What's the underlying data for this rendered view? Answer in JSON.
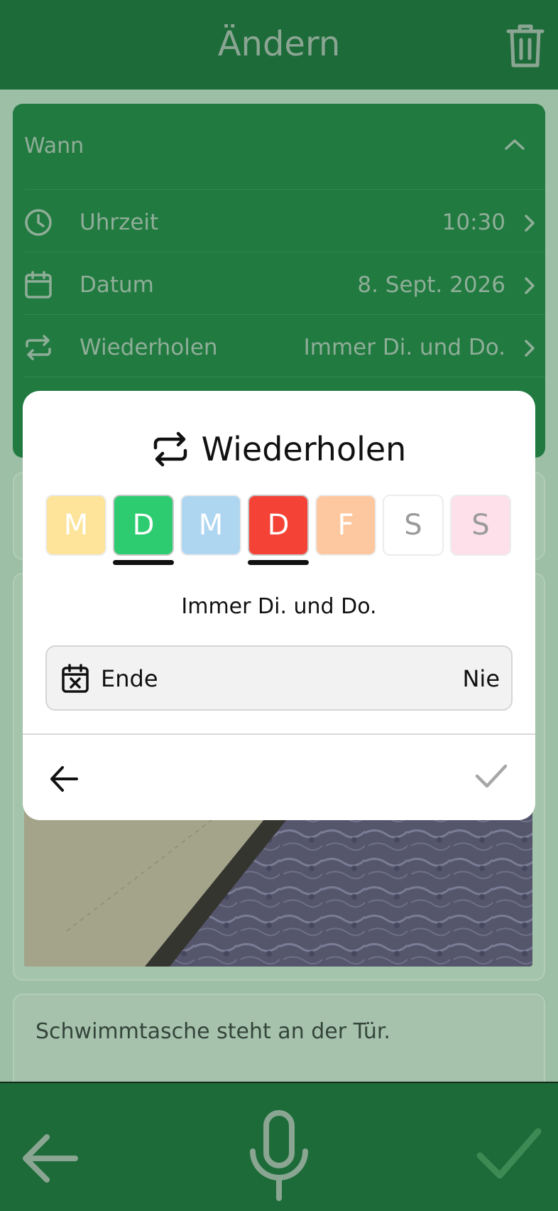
{
  "header": {
    "title": "Ändern",
    "trash_icon": "trash-icon"
  },
  "wann": {
    "title": "Wann",
    "rows": [
      {
        "label": "Uhrzeit",
        "value": "10:30",
        "icon": "clock-icon"
      },
      {
        "label": "Datum",
        "value": "8. Sept. 2026",
        "icon": "calendar-icon"
      },
      {
        "label": "Wiederholen",
        "value": "Immer Di. und Do.",
        "icon": "repeat-icon"
      }
    ]
  },
  "note": {
    "text": "Schwimmtasche steht an der Tür."
  },
  "modal": {
    "title": "Wiederholen",
    "days": [
      {
        "letter": "M",
        "color": "#fde49a",
        "selected": false
      },
      {
        "letter": "D",
        "color": "#2ecc71",
        "selected": true
      },
      {
        "letter": "M",
        "color": "#aed6f1",
        "selected": false
      },
      {
        "letter": "D",
        "color": "#f44336",
        "selected": true
      },
      {
        "letter": "F",
        "color": "#fdc8a0",
        "selected": false
      },
      {
        "letter": "S",
        "color": "#ffffff",
        "selected": false
      },
      {
        "letter": "S",
        "color": "#fde0ea",
        "selected": false
      }
    ],
    "summary": "Immer Di. und Do.",
    "end": {
      "label": "Ende",
      "value": "Nie"
    }
  },
  "colors": {
    "primary_green": "#1d6b39",
    "card_green": "#217a40",
    "dimmed_text": "#8fae98"
  }
}
